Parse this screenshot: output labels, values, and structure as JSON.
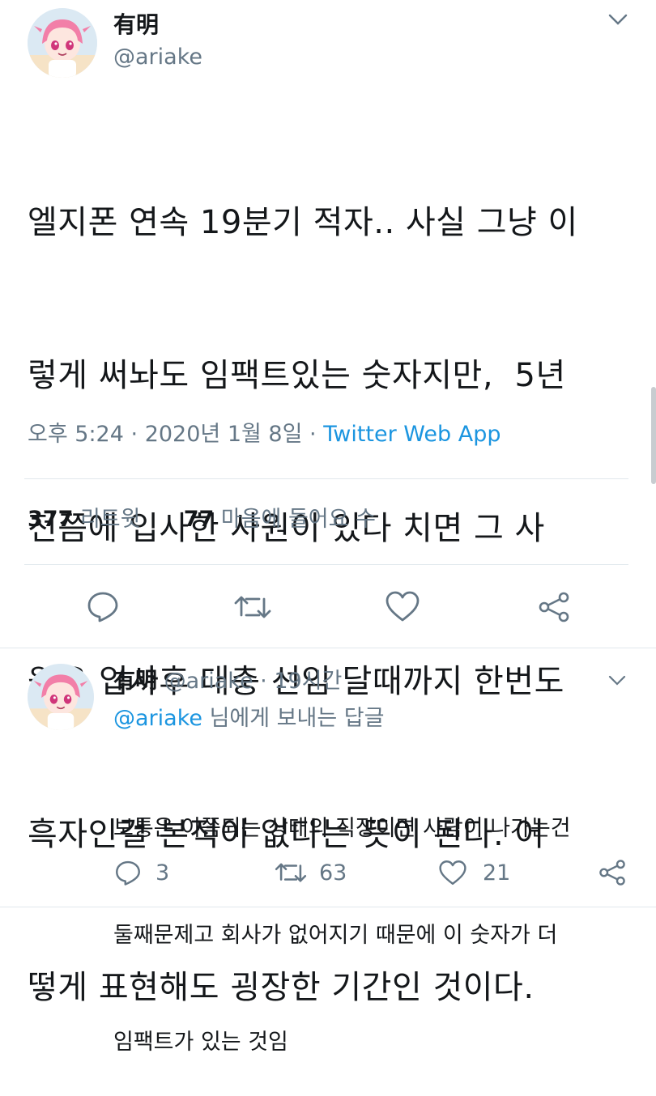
{
  "tweet": {
    "display_name": "有明",
    "handle": "@ariake",
    "text_lines": [
      "엘지폰 연속 19분기 적자.. 사실 그냥 이",
      "렇게 써놔도 임팩트있는 숫자지만,  5년",
      "전쯤에 입사한 사원이 있다 치면 그 사",
      "원은 입사후 대충 선임 달때까지 한번도",
      "흑자인걸 본적이 없다는 뜻이 된다. 어",
      "떻게 표현해도 굉장한 기간인 것이다."
    ],
    "time": "오후 5:24",
    "sep1": "·",
    "date": "2020년 1월 8일",
    "sep2": "·",
    "source": "Twitter Web App",
    "retweet_count": "377",
    "retweet_label": "리트윗",
    "like_count": "77",
    "like_label": "마음에 들어요 수"
  },
  "reply": {
    "display_name": "有明",
    "handle": "@ariake",
    "sep": "·",
    "time_ago": "19시간",
    "replying_to_handle": "@ariake",
    "replying_to_suffix": "님에게 보내는 답글",
    "text_lines": [
      "보통은 이쯤되는 상태의 직장이면 사람이 나가는건",
      "둘째문제고 회사가 없어지기 때문에 이 숫자가 더",
      "임팩트가 있는 것임"
    ],
    "reply_count": "3",
    "retweet_count": "63",
    "like_count": "21"
  },
  "icons": {
    "chevron": "chevron-down-icon",
    "reply": "reply-icon",
    "retweet": "retweet-icon",
    "like": "heart-icon",
    "share": "share-icon"
  },
  "colors": {
    "link": "#1b95e0",
    "muted": "#657786",
    "icon": "#657786",
    "text": "#14171a",
    "divider": "#e1e8ed"
  }
}
